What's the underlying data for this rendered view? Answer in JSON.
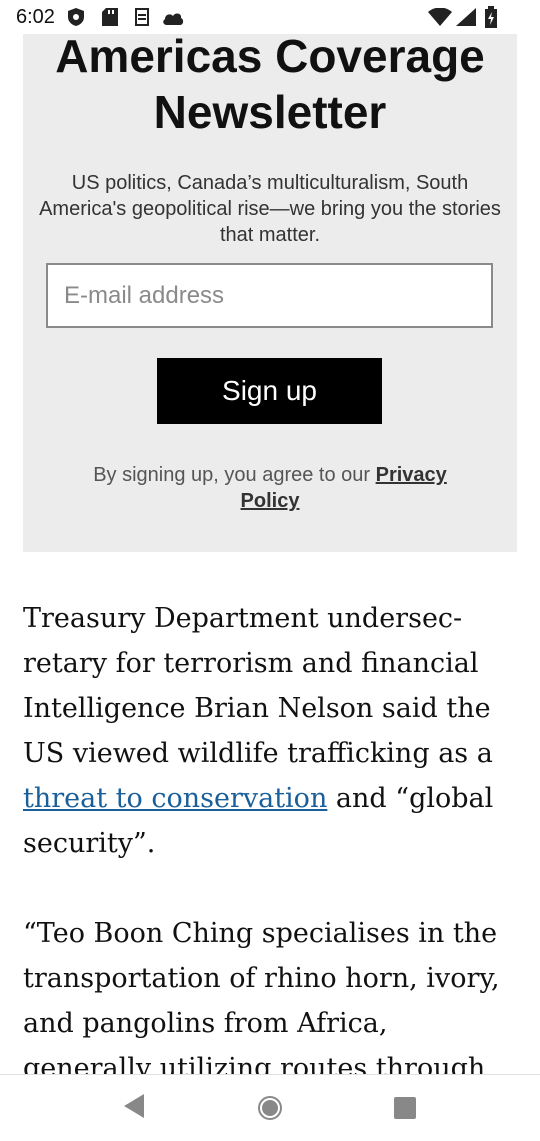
{
  "status_bar": {
    "time": "6:02",
    "icons": [
      "shield-icon",
      "sd-card-icon",
      "sync-icon",
      "cloud-icon",
      "wifi-icon",
      "signal-icon",
      "battery-icon"
    ]
  },
  "newsletter": {
    "title": "Americas Coverage Newsletter",
    "description": "US politics, Canada’s multiculturalism, South America's geopolitical rise—we bring you the stories that matter.",
    "email_placeholder": "E-mail address",
    "signup_label": "Sign up",
    "legal_prefix": "By signing up, you agree to our ",
    "privacy_link": "Privacy Policy",
    "background": "#ececec"
  },
  "article": {
    "paragraph1_before": "Treasury Department undersec-retary for terrorism and financial Intelligence Brian Nelson said the US viewed wildlife trafficking as a ",
    "paragraph1_link": "threat to conservation",
    "paragraph1_after": " and “global security”.",
    "paragraph2": "“Teo Boon Ching specialises in the transportation of rhino horn, ivory, and pangolins from Africa, generally utilizing routes through",
    "link_color": "#1a5f9a"
  },
  "nav_bar": {
    "buttons": [
      "back-icon",
      "home-icon",
      "recents-icon"
    ]
  }
}
